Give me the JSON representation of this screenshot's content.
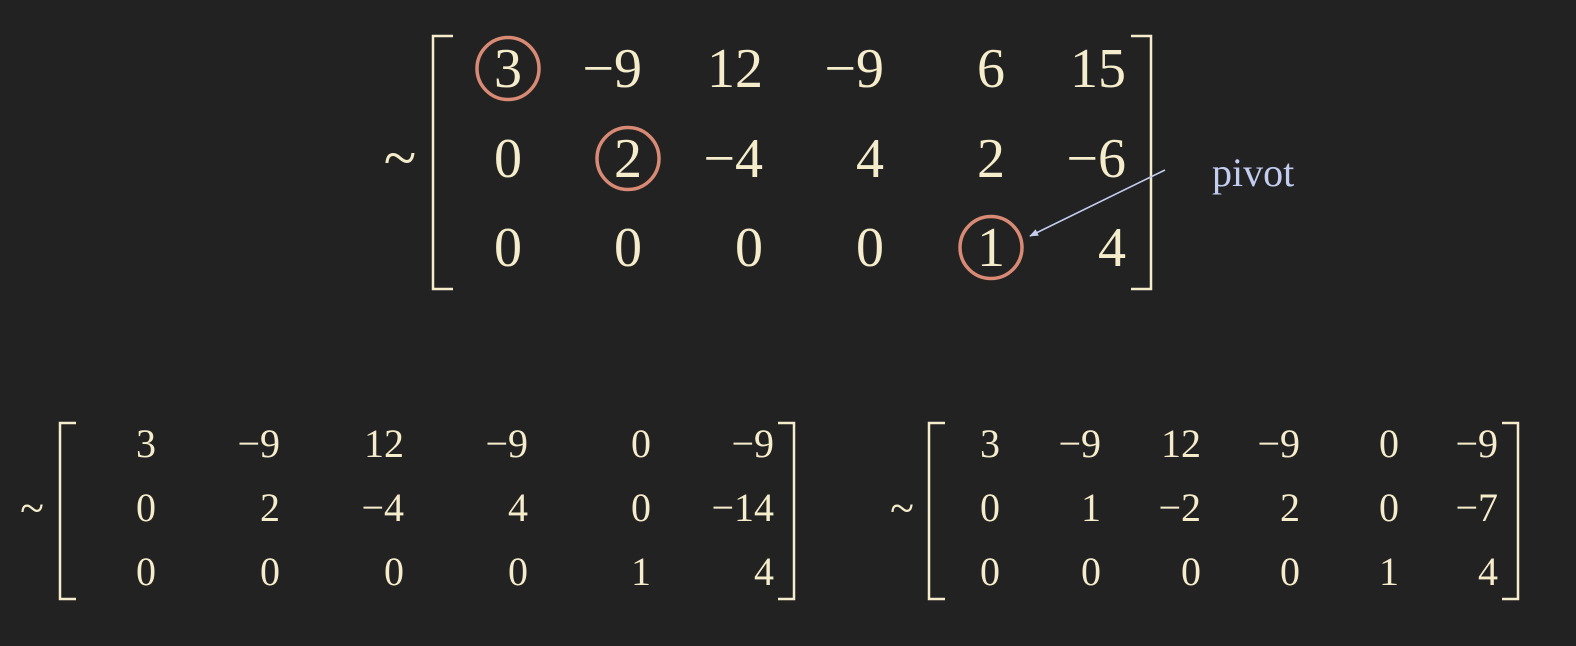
{
  "colors": {
    "background": "#222222",
    "matrix_text": "#f4ecca",
    "pivot_circle": "#d98a74",
    "annotation": "#c3cdf0"
  },
  "annotation": {
    "label": "pivot",
    "target": "matrix-1 row 3 column 5"
  },
  "matrices": [
    {
      "id": "matrix-1",
      "prefix": "~",
      "rows": [
        [
          "3",
          "−9",
          "12",
          "−9",
          "6",
          "15"
        ],
        [
          "0",
          "2",
          "−4",
          "4",
          "2",
          "−6"
        ],
        [
          "0",
          "0",
          "0",
          "0",
          "1",
          "4"
        ]
      ],
      "pivots": [
        [
          0,
          0
        ],
        [
          1,
          1
        ],
        [
          2,
          4
        ]
      ]
    },
    {
      "id": "matrix-2",
      "prefix": "~",
      "rows": [
        [
          "3",
          "−9",
          "12",
          "−9",
          "0",
          "−9"
        ],
        [
          "0",
          "2",
          "−4",
          "4",
          "0",
          "−14"
        ],
        [
          "0",
          "0",
          "0",
          "0",
          "1",
          "4"
        ]
      ],
      "pivots": []
    },
    {
      "id": "matrix-3",
      "prefix": "~",
      "rows": [
        [
          "3",
          "−9",
          "12",
          "−9",
          "0",
          "−9"
        ],
        [
          "0",
          "1",
          "−2",
          "2",
          "0",
          "−7"
        ],
        [
          "0",
          "0",
          "0",
          "0",
          "1",
          "4"
        ]
      ],
      "pivots": []
    }
  ]
}
